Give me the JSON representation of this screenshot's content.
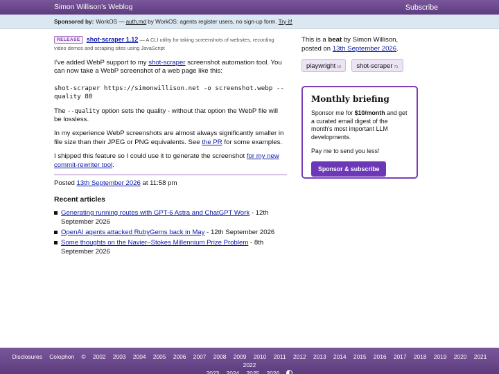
{
  "header": {
    "site_title": "Simon Willison’s Weblog",
    "subscribe_label": "Subscribe"
  },
  "sponsor": {
    "label": "Sponsored by:",
    "text_before": "WorkOS —",
    "link_text": "auth.md",
    "text_after": "by WorkOS: agents register users, no sign-up form.",
    "cta": "Try it!"
  },
  "post": {
    "badge": "RELEASE",
    "release_title": "shot-scraper 1.12",
    "release_desc": "— A CLI utility for taking screenshots of websites, recording video demos and scraping sites using JavaScript",
    "p1_before": "I’ve added WebP support to my",
    "p1_link": "shot-scraper",
    "p1_after": "screenshot automation tool. You can now take a WebP screenshot of a web page like this:",
    "code": "shot-scraper https://simonwillison.net -o screenshot.webp --quality 80",
    "p2_before": "The",
    "p2_code": "--quality",
    "p2_after": "option sets the quality - without that option the WebP file will be lossless.",
    "p3_before": "In my experience WebP screenshots are almost always significantly smaller in file size than their JPEG or PNG equivalents. See",
    "p3_link": "the PR",
    "p3_after": "for some examples.",
    "p4_before": "I shipped this feature so I could use it to generate the screenshot",
    "p4_link": "for my new commit-rewriter tool",
    "p4_after": ".",
    "posted_label": "Posted",
    "posted_date": "13th September 2026",
    "posted_time": "at 11:58 pm"
  },
  "recent": {
    "heading": "Recent articles",
    "items": [
      {
        "title": "Generating running routes with GPT-6 Astra and ChatGPT Work",
        "date": "- 12th September 2026"
      },
      {
        "title": "OpenAI agents attacked RubyGems back in May",
        "date": "- 12th September 2026"
      },
      {
        "title": "Some thoughts on the Navier–Stokes Millennium Prize Problem",
        "date": "- 8th September 2026"
      }
    ]
  },
  "sidebar": {
    "beat_prefix": "This is a",
    "beat_word": "beat",
    "beat_by": "by Simon Willison, posted on",
    "beat_date": "13th September 2026",
    "beat_end": ".",
    "tags": [
      {
        "name": "playwright",
        "count": "16"
      },
      {
        "name": "shot-scraper",
        "count": "71"
      }
    ],
    "briefing": {
      "title": "Monthly briefing",
      "text_before": "Sponsor me for",
      "price": "$10/month",
      "text_after": "and get a curated email digest of the month's most important LLM developments.",
      "pay_text": "Pay me to send you less!",
      "button": "Sponsor & subscribe"
    }
  },
  "footer": {
    "links": [
      "Disclosures",
      "Colophon",
      "©",
      "2002",
      "2003",
      "2004",
      "2005",
      "2006",
      "2007",
      "2008",
      "2009",
      "2010",
      "2011",
      "2012",
      "2013",
      "2014",
      "2015",
      "2016",
      "2017",
      "2018",
      "2019",
      "2020",
      "2021",
      "2022",
      "2023",
      "2024",
      "2025",
      "2026"
    ]
  }
}
